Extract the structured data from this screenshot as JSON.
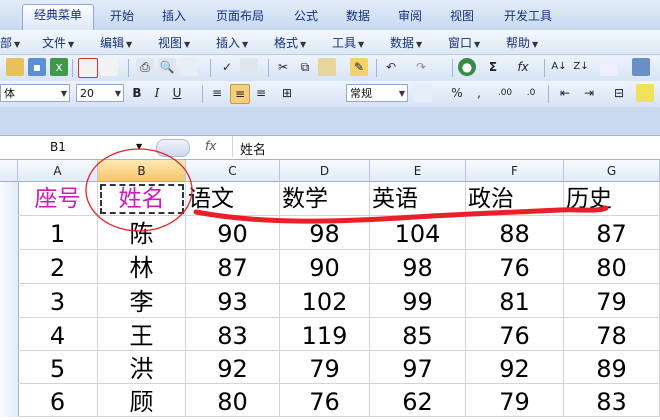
{
  "tabs": [
    "经典菜单",
    "开始",
    "插入",
    "页面布局",
    "公式",
    "数据",
    "审阅",
    "视图",
    "开发工具"
  ],
  "menus": [
    "部",
    "文件",
    "编辑",
    "视图",
    "插入",
    "格式",
    "工具",
    "数据",
    "窗口",
    "帮助"
  ],
  "toolbar": {
    "font_name": "体",
    "font_size": "20",
    "number_format": "常规",
    "bold": "B",
    "italic": "I",
    "underline": "U",
    "sum": "Σ",
    "fx": "fx"
  },
  "formula_bar": {
    "name_box": "B1",
    "fx_label": "fx",
    "content": "姓名"
  },
  "columns": [
    "A",
    "B",
    "C",
    "D",
    "E",
    "F",
    "G"
  ],
  "header_row": [
    "座号",
    "姓名",
    "语文",
    "数学",
    "英语",
    "政治",
    "历史"
  ],
  "rows": [
    [
      "1",
      "陈",
      "90",
      "98",
      "104",
      "88",
      "87"
    ],
    [
      "2",
      "林",
      "87",
      "90",
      "98",
      "76",
      "80"
    ],
    [
      "3",
      "李",
      "93",
      "102",
      "99",
      "81",
      "79"
    ],
    [
      "4",
      "王",
      "83",
      "119",
      "85",
      "76",
      "78"
    ],
    [
      "5",
      "洪",
      "92",
      "79",
      "97",
      "92",
      "89"
    ],
    [
      "6",
      "顾",
      "80",
      "76",
      "62",
      "79",
      "83"
    ]
  ],
  "colors": {
    "header_pink": "#d21bb6",
    "annotation_red": "#e8202a",
    "ribbon_blue": "#c7d9f0"
  }
}
